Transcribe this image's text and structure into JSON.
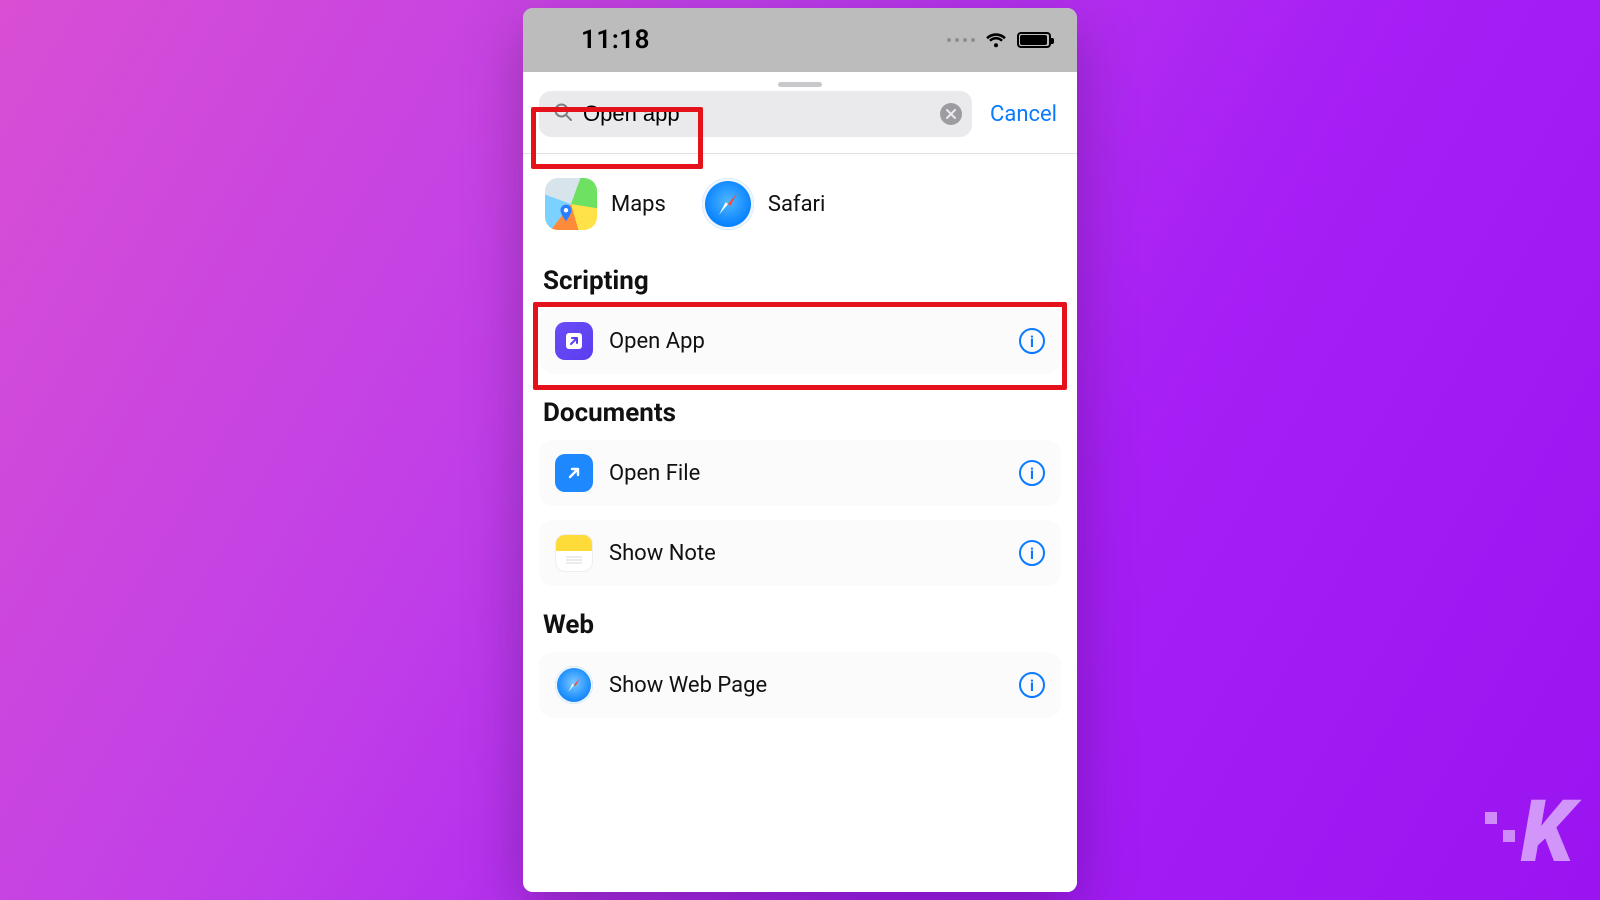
{
  "statusbar": {
    "time": "11:18"
  },
  "search": {
    "value": "Open app",
    "cancel": "Cancel"
  },
  "suggestions": [
    {
      "label": "Maps"
    },
    {
      "label": "Safari"
    }
  ],
  "sections": {
    "scripting": {
      "title": "Scripting",
      "actions": [
        {
          "title": "Open App"
        }
      ]
    },
    "documents": {
      "title": "Documents",
      "actions": [
        {
          "title": "Open File"
        },
        {
          "title": "Show Note"
        }
      ]
    },
    "web": {
      "title": "Web",
      "actions": [
        {
          "title": "Show Web Page"
        }
      ]
    }
  },
  "watermark": "K"
}
